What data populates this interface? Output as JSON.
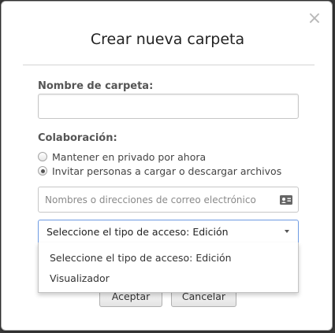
{
  "dialog": {
    "title": "Crear nueva carpeta",
    "close_glyph": "×"
  },
  "folder_name": {
    "label": "Nombre de carpeta:",
    "value": ""
  },
  "collaboration": {
    "label": "Colaboración:",
    "options": [
      {
        "label": "Mantener en privado por ahora",
        "selected": false
      },
      {
        "label": "Invitar personas a cargar o descargar archivos",
        "selected": true
      }
    ]
  },
  "invite": {
    "placeholder": "Nombres o direcciones de correo electrónico"
  },
  "access_select": {
    "value": "Seleccione el tipo de acceso: Edición",
    "options": [
      "Seleccione el tipo de acceso: Edición",
      "Visualizador"
    ]
  },
  "buttons": {
    "accept": "Aceptar",
    "cancel": "Cancelar"
  },
  "colors": {
    "focus_border": "#6d9ae2",
    "backdrop": "#3a3a3a"
  }
}
